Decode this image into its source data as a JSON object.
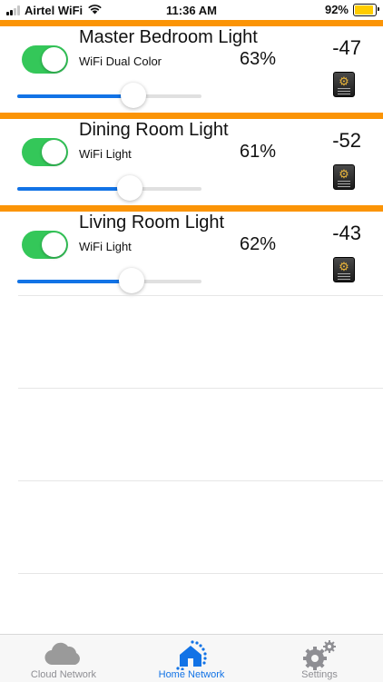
{
  "status_bar": {
    "carrier": "Airtel WiFi",
    "time": "11:36 AM",
    "battery": "92%",
    "battery_level": 0.92,
    "signal_bars": 2
  },
  "colors": {
    "accent_orange": "#fb9406",
    "toggle_green": "#34c759",
    "slider_blue": "#1273e6",
    "tab_active": "#1273e6",
    "tab_inactive": "#8e8e93"
  },
  "devices": [
    {
      "name": "Master Bedroom Light",
      "type": "WiFi Dual Color",
      "brightness": "63%",
      "level": 63,
      "rssi": "-47",
      "on": true,
      "settings_icon": "gear-app-icon"
    },
    {
      "name": "Dining Room Light",
      "type": "WiFi Light",
      "brightness": "61%",
      "level": 61,
      "rssi": "-52",
      "on": true,
      "settings_icon": "gear-app-icon"
    },
    {
      "name": "Living Room Light",
      "type": "WiFi Light",
      "brightness": "62%",
      "level": 62,
      "rssi": "-43",
      "on": true,
      "settings_icon": "gear-app-icon"
    }
  ],
  "tabs": [
    {
      "label": "Cloud Network",
      "icon": "cloud-icon",
      "active": false
    },
    {
      "label": "Home Network",
      "icon": "home-network-icon",
      "active": true
    },
    {
      "label": "Settings",
      "icon": "gears-icon",
      "active": false
    }
  ]
}
